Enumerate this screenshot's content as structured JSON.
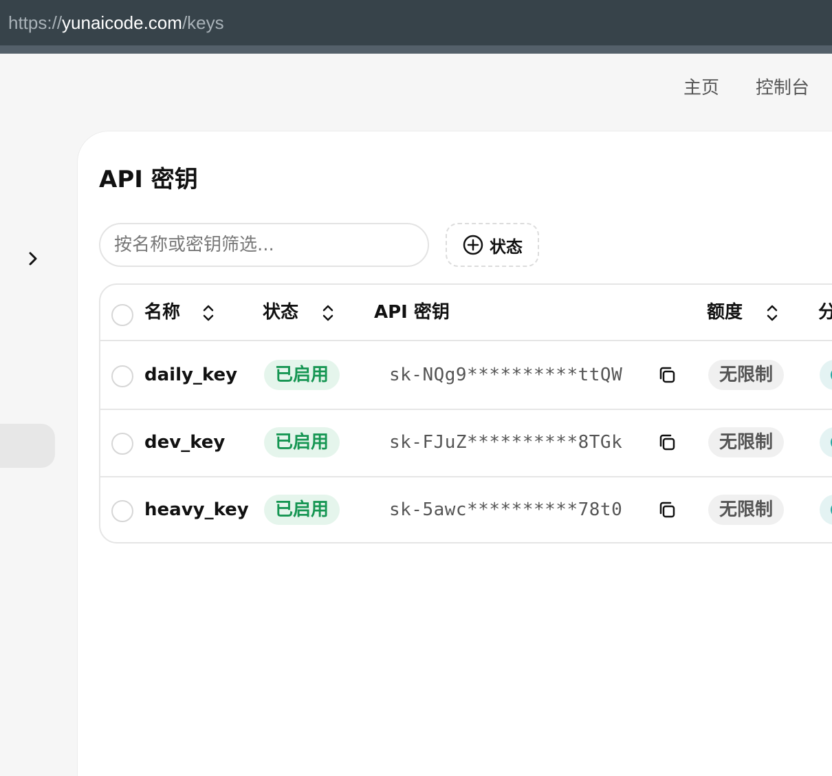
{
  "browser": {
    "url_scheme": "https://",
    "url_host": "yunaicode.com",
    "url_path": "/keys"
  },
  "nav": {
    "home": "主页",
    "console": "控制台"
  },
  "page": {
    "title": "API 密钥"
  },
  "filters": {
    "search_placeholder": "按名称或密钥筛选...",
    "status_label": "状态"
  },
  "table": {
    "headers": {
      "name": "名称",
      "status": "状态",
      "api_key": "API 密钥",
      "quota": "额度",
      "partial_next": "分"
    },
    "rows": [
      {
        "name": "daily_key",
        "status": "已启用",
        "key": "sk-NQg9**********ttQW",
        "quota": "无限制"
      },
      {
        "name": "dev_key",
        "status": "已启用",
        "key": "sk-FJuZ**********8TGk",
        "quota": "无限制"
      },
      {
        "name": "heavy_key",
        "status": "已启用",
        "key": "sk-5awc**********78t0",
        "quota": "无限制"
      }
    ]
  },
  "colors": {
    "urlbar": "#37434a",
    "enabled_text": "#169653",
    "enabled_bg": "#e5f5ec",
    "limit_bg": "#f0f0f0"
  },
  "icons": {
    "sidebar_toggle": "chevron-right-icon",
    "filter_add": "plus-circle-icon",
    "sort": "sort-updown-icon",
    "copy": "copy-icon"
  }
}
